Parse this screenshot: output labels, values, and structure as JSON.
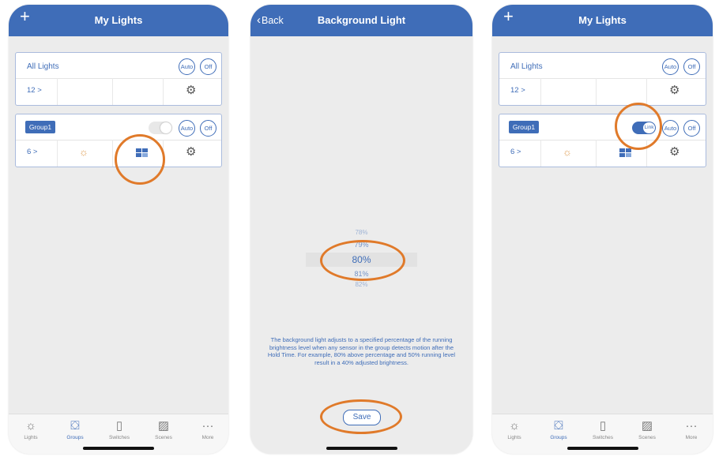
{
  "screens": {
    "my_lights_1": {
      "title": "My Lights",
      "plus_icon": "+",
      "all_lights": {
        "label": "All Lights",
        "auto": "Auto",
        "off": "Off",
        "count": "12 >"
      },
      "group": {
        "label": "Group1",
        "auto": "Auto",
        "off": "Off",
        "count": "6 >"
      }
    },
    "background_light": {
      "title": "Background Light",
      "back_label": "Back",
      "picker_values": [
        "78%",
        "79%",
        "80%",
        "81%",
        "82%"
      ],
      "selected_value": "80%",
      "explanation": "The background light adjusts to a specified percentage of the running brightness level when any sensor in the group detects motion after the Hold Time. For example, 80% above percentage and 50% running level result in a 40% adjusted brightness.",
      "save_label": "Save"
    },
    "my_lights_2": {
      "title": "My Lights",
      "plus_icon": "+",
      "all_lights": {
        "label": "All Lights",
        "auto": "Auto",
        "off": "Off",
        "count": "12 >"
      },
      "group": {
        "label": "Group1",
        "auto": "Auto",
        "off": "Off",
        "count": "6 >",
        "link_label": "Link"
      }
    }
  },
  "tabbar": {
    "items": [
      {
        "label": "Lights",
        "icon": "sun-icon"
      },
      {
        "label": "Groups",
        "icon": "groups-icon"
      },
      {
        "label": "Switches",
        "icon": "switch-icon"
      },
      {
        "label": "Scenes",
        "icon": "scenes-icon"
      },
      {
        "label": "More",
        "icon": "more-icon"
      }
    ],
    "active": "Groups"
  },
  "colors": {
    "brand_blue": "#3f6db8",
    "highlight_ring": "#e07a2a",
    "screen_bg": "#ececec"
  }
}
